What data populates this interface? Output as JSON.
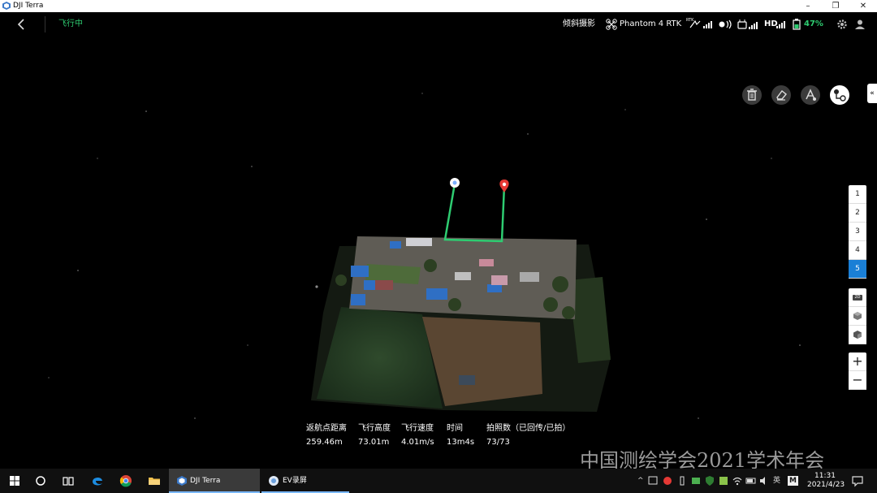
{
  "window": {
    "title": "DJI Terra",
    "controls": [
      "–",
      "❐",
      "✕"
    ]
  },
  "topbar": {
    "status": "飞行中",
    "mission": "倾斜摄影",
    "drone_model": "Phantom 4 RTK",
    "rtk_label": "RTK",
    "hd_label": "HD",
    "battery": "47%"
  },
  "toolbar": {
    "icons": [
      "trash-icon",
      "eraser-icon",
      "marker-icon",
      "route-icon"
    ]
  },
  "layers": {
    "items": [
      "1",
      "2",
      "3",
      "4",
      "5"
    ],
    "selected": "5"
  },
  "views": {
    "mode_2d": "2D"
  },
  "zoom": {
    "in": "+",
    "out": "−"
  },
  "stats": [
    {
      "label": "返航点距离",
      "value": "259.46m"
    },
    {
      "label": "飞行高度",
      "value": "73.01m"
    },
    {
      "label": "飞行速度",
      "value": "4.01m/s"
    },
    {
      "label": "时间",
      "value": "13m4s"
    },
    {
      "label": "拍照数（已回传/已拍）",
      "value": "73/73"
    }
  ],
  "watermark": "中国测绘学会2021学术年会",
  "taskbar": {
    "apps": [
      {
        "label": "DJI Terra",
        "active": true
      },
      {
        "label": "EV录屏",
        "active": false
      }
    ],
    "ime": "英",
    "ime_mode": "M",
    "time": "11:31",
    "date": "2021/4/23"
  },
  "colors": {
    "accent_green": "#2ecc71",
    "selected_blue": "#1a7fd6",
    "route_green": "#2ecc71",
    "marker_red": "#e53935"
  }
}
